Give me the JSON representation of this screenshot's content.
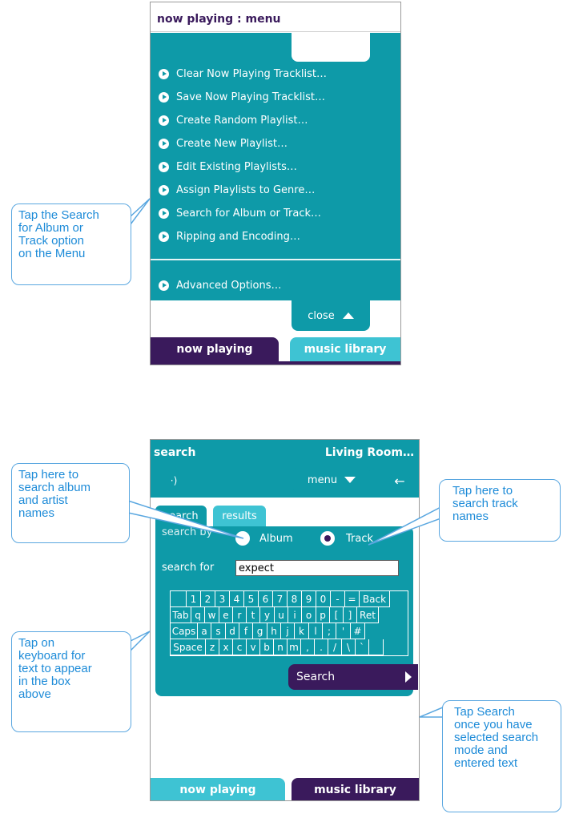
{
  "screen1": {
    "title": "now playing : menu",
    "menu_items": [
      "Clear Now Playing Tracklist…",
      "Save Now Playing Tracklist…",
      "Create Random Playlist…",
      "Create New Playlist…",
      "Edit Existing Playlists…",
      "Assign Playlists to Genre…",
      "Search for Album or Track…",
      "Ripping and Encoding…"
    ],
    "advanced_item": "Advanced Options…",
    "close_label": "close",
    "tabs": {
      "now_playing": "now playing",
      "music_library": "music library"
    },
    "colors": {
      "teal": "#0e9aa8",
      "purple": "#3a1a5c",
      "light_teal": "#3ec3d3"
    }
  },
  "screen2": {
    "title": "search",
    "location": "Living Room…",
    "menu_label": "menu",
    "tabs": {
      "search": "search",
      "results": "results"
    },
    "search_by_label": "search by",
    "radio_album": "Album",
    "radio_track": "Track",
    "selected_mode": "Track",
    "search_for_label": "search for",
    "search_value": "expect",
    "keyboard_rows": [
      [
        "",
        "1",
        "2",
        "3",
        "4",
        "5",
        "6",
        "7",
        "8",
        "9",
        "0",
        "-",
        "=",
        "Back"
      ],
      [
        "Tab",
        "q",
        "w",
        "e",
        "r",
        "t",
        "y",
        "u",
        "i",
        "o",
        "p",
        "[",
        "]",
        "Ret"
      ],
      [
        "Caps",
        "a",
        "s",
        "d",
        "f",
        "g",
        "h",
        "j",
        "k",
        "l",
        ";",
        "'",
        "#"
      ],
      [
        "Space",
        "z",
        "x",
        "c",
        "v",
        "b",
        "n",
        "m",
        ",",
        ".",
        "/",
        "\\",
        "`",
        ""
      ]
    ],
    "search_button": "Search",
    "bottom_tabs": {
      "now_playing": "now playing",
      "music_library": "music library"
    }
  },
  "callouts": {
    "search_menu": [
      "Tap the Search",
      "for Album or",
      "Track option",
      "on the Menu"
    ],
    "album_artist": [
      "Tap here to",
      "search album",
      "and artist",
      "names"
    ],
    "track": [
      "Tap here to",
      "search track",
      "names"
    ],
    "keyboard": [
      "Tap on",
      "keyboard for",
      "text to appear",
      "in the box",
      "above"
    ],
    "search_btn": [
      "Tap Search",
      "once you have",
      "selected search",
      "mode and",
      "entered text"
    ]
  },
  "icons": {
    "speaker": "speaker-icon",
    "back": "back-arrow-icon",
    "bullet": "play-bullet-icon",
    "close": "triangle-up-icon",
    "menu": "triangle-down-icon",
    "search": "triangle-right-icon"
  }
}
